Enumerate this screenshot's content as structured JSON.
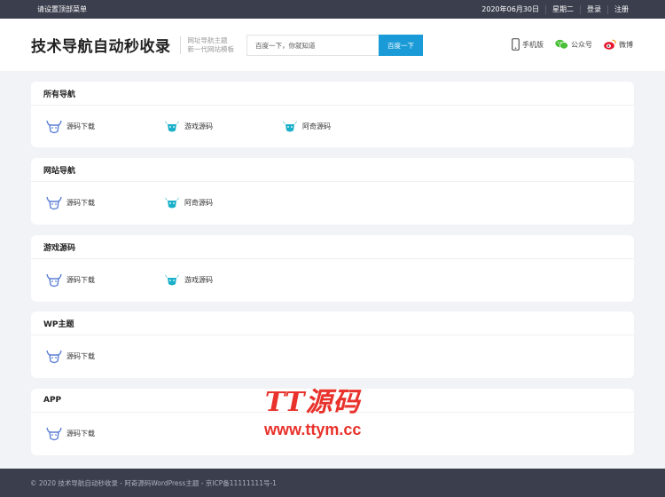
{
  "topbar": {
    "menu_label": "请设置顶部菜单",
    "date": "2020年06月30日",
    "weekday": "星期二",
    "login": "登录",
    "register": "注册"
  },
  "header": {
    "logo": "技术导航自动秒收录",
    "tagline_1": "网址导航主题",
    "tagline_2": "新一代网站模板",
    "search_placeholder": "百度一下，你就知道",
    "search_button": "百度一下",
    "mobile": "手机版",
    "wechat": "公众号",
    "weibo": "微博"
  },
  "sections": [
    {
      "title": "所有导航",
      "links": [
        {
          "label": "源码下载",
          "icon": "bull-icon-blue"
        },
        {
          "label": "游戏源码",
          "icon": "bull-icon-teal"
        },
        {
          "label": "阿奇源码",
          "icon": "bull-icon-teal"
        }
      ]
    },
    {
      "title": "网站导航",
      "links": [
        {
          "label": "源码下载",
          "icon": "bull-icon-blue"
        },
        {
          "label": "阿奇源码",
          "icon": "bull-icon-teal"
        }
      ]
    },
    {
      "title": "游戏源码",
      "links": [
        {
          "label": "源码下载",
          "icon": "bull-icon-blue"
        },
        {
          "label": "游戏源码",
          "icon": "bull-icon-teal"
        }
      ]
    },
    {
      "title": "WP主题",
      "links": [
        {
          "label": "源码下载",
          "icon": "bull-icon-blue"
        }
      ]
    },
    {
      "title": "APP",
      "links": [
        {
          "label": "源码下载",
          "icon": "bull-icon-blue"
        }
      ]
    }
  ],
  "footer": {
    "copyright": "© 2020 技术导航自动秒收录 - 阿奇源码WordPress主题 - 京ICP备11111111号-1"
  },
  "watermark": {
    "brand": "TT源码",
    "url": "www.ttym.cc"
  },
  "colors": {
    "topbar_bg": "#3b3f4d",
    "search_button": "#1a9bd7",
    "icon_blue": "#5b7fd6",
    "icon_teal": "#1bb0c9",
    "watermark": "#e8322b"
  }
}
